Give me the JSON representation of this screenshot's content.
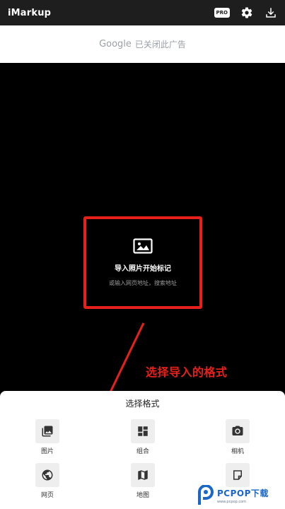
{
  "appbar": {
    "title": "iMarkup",
    "pro_badge": "PRO",
    "icons": [
      "pro-badge",
      "gear-icon",
      "download-icon"
    ]
  },
  "ad": {
    "brand": "Google",
    "text": "已关闭此广告"
  },
  "import_box": {
    "title": "导入照片开始标记",
    "subtitle": "或输入网页地址，搜索地址",
    "icon": "image-icon"
  },
  "annotation": {
    "text": "选择导入的格式",
    "color": "#e8201c"
  },
  "sheet": {
    "title": "选择格式",
    "items": [
      {
        "label": "图片",
        "icon": "photo-library-icon"
      },
      {
        "label": "组合",
        "icon": "collage-icon"
      },
      {
        "label": "相机",
        "icon": "camera-icon"
      },
      {
        "label": "网页",
        "icon": "globe-icon"
      },
      {
        "label": "地图",
        "icon": "map-icon"
      },
      {
        "label": "",
        "icon": "note-icon"
      }
    ]
  },
  "watermark": {
    "brand_main": "PCPOP",
    "brand_suffix": "下载",
    "sub": "www.pcpop.com"
  }
}
